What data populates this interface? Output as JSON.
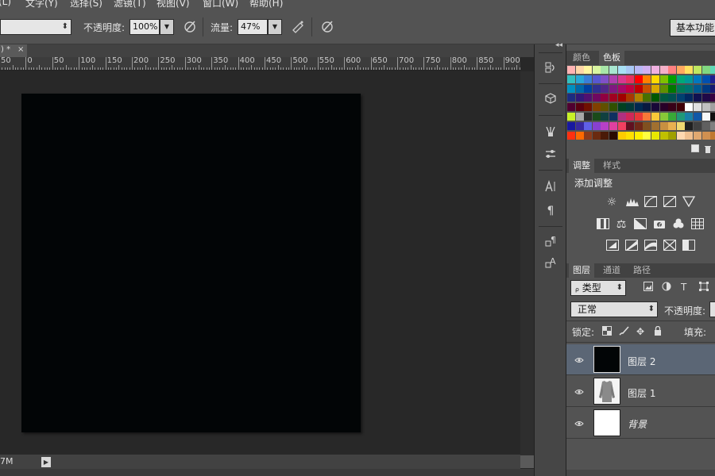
{
  "menu": [
    "(L)",
    "文字(Y)",
    "选择(S)",
    "滤镜(T)",
    "视图(V)",
    "窗口(W)",
    "帮助(H)"
  ],
  "options": {
    "dropdown_arrow": "⬍",
    "opacity_label": "不透明度:",
    "opacity_value": "100%",
    "flow_label": "流量:",
    "flow_value": "47%",
    "workspace_label": "基本功能"
  },
  "document": {
    "tab_label": ") *",
    "tab_close": "×",
    "ruler_ticks": [
      "50",
      "0",
      "50",
      "100",
      "150",
      "200",
      "250",
      "300",
      "350",
      "400",
      "450",
      "500",
      "550",
      "600",
      "650",
      "700",
      "750",
      "800",
      "850",
      "900"
    ],
    "status_text": "7M",
    "canvas_color": "#020506"
  },
  "panels": {
    "collapse_glyph": "◂◂",
    "swatches_tabs": [
      "颜色",
      "色板"
    ],
    "adjust_tabs": [
      "调整",
      "样式"
    ],
    "adjust_title": "添加调整",
    "layers_tabs": [
      "图层",
      "通道",
      "路径"
    ],
    "filter_label": "ᵨ 类型",
    "blend_mode": "正常",
    "opacity_label": "不透明度:",
    "lock_label": "锁定:",
    "fill_label": "填充:",
    "layers": [
      {
        "name": "图层 2",
        "selected": true
      },
      {
        "name": "图层 1",
        "selected": false
      },
      {
        "name": "背景",
        "selected": false
      }
    ]
  },
  "icons": [
    "brush-pressure-icon",
    "airbrush-icon",
    "tablet-pressure-icon",
    "history-icon",
    "3d-icon",
    "brush-icon",
    "brush-preset-icon",
    "character-icon",
    "paragraph-icon",
    "character-style-icon",
    "paragraph-style-icon",
    "eye-icon"
  ],
  "colors": {
    "swatches": [
      [
        "#ffb3b3",
        "#ffd5a8",
        "#fff5a0",
        "#d9f5a0",
        "#a8e6a8",
        "#a8e6d0",
        "#a8e0f5",
        "#a8c8f5",
        "#b8b8f5",
        "#d0b0f0",
        "#f0b0e0",
        "#f5b0c8",
        "#ff8080",
        "#ffa860",
        "#ffe060",
        "#c0e860",
        "#80d880",
        "#60d8b8"
      ],
      [
        "#33c0c0",
        "#2aa8d8",
        "#3a7ed8",
        "#5858d0",
        "#8050c8",
        "#b040b0",
        "#d83890",
        "#e83060",
        "#ff0000",
        "#ff8000",
        "#ffd800",
        "#80c000",
        "#00a000",
        "#00a878",
        "#009898",
        "#0078c0",
        "#0050b0",
        "#202090"
      ],
      [
        "#0090c0",
        "#0068a8",
        "#0040a0",
        "#303090",
        "#502888",
        "#801880",
        "#a80868",
        "#c00040",
        "#c00000",
        "#c85000",
        "#d8a800",
        "#609000",
        "#007800",
        "#007858",
        "#007070",
        "#005890",
        "#003880",
        "#181870"
      ],
      [
        "#1c2c80",
        "#301878",
        "#501070",
        "#700860",
        "#900040",
        "#a00020",
        "#a00000",
        "#a83800",
        "#b08000",
        "#487000",
        "#005800",
        "#005840",
        "#005050",
        "#004070",
        "#002860",
        "#101050",
        "#200848",
        "#380040"
      ],
      [
        "#500030",
        "#5a0010",
        "#701000",
        "#804000",
        "#605000",
        "#305000",
        "#004020",
        "#003838",
        "#002850",
        "#081840",
        "#180838",
        "#280028",
        "#380018",
        "#400008",
        "#ffffff",
        "#e0e0e0",
        "#c0c0c0",
        "#a0a0a0"
      ],
      [
        "#c8f028",
        "#a8a8a8",
        "#2a2a2a",
        "#1a4a1a",
        "#104040",
        "#103060",
        "#b03080",
        "#d02858",
        "#e83838",
        "#f87838",
        "#f8c838",
        "#88c838",
        "#38a838",
        "#209878",
        "#1880a8",
        "#1058a8",
        "#f8f8f8",
        "#101010"
      ],
      [
        "#1818a0",
        "#3828a0",
        "#6060e8",
        "#8840d0",
        "#b840c8",
        "#e040a0",
        "#f04060",
        "#601020",
        "#702818",
        "#805020",
        "#a07030",
        "#c89040",
        "#e8b050",
        "#f0d870",
        "#202020",
        "#404040",
        "#606060",
        "#808080"
      ],
      [
        "#ff3010",
        "#ff6a00",
        "#8b3a1a",
        "#6a2a10",
        "#4a1a08",
        "#2a0a00",
        "#ffcc00",
        "#ffe000",
        "#fff000",
        "#ffff40",
        "#e8e800",
        "#c0c000",
        "#a0a000",
        "#ffd8b0",
        "#f0c090",
        "#e0a870",
        "#d09050",
        "#c07830"
      ]
    ],
    "selected_layer_row": "#5b6675"
  }
}
